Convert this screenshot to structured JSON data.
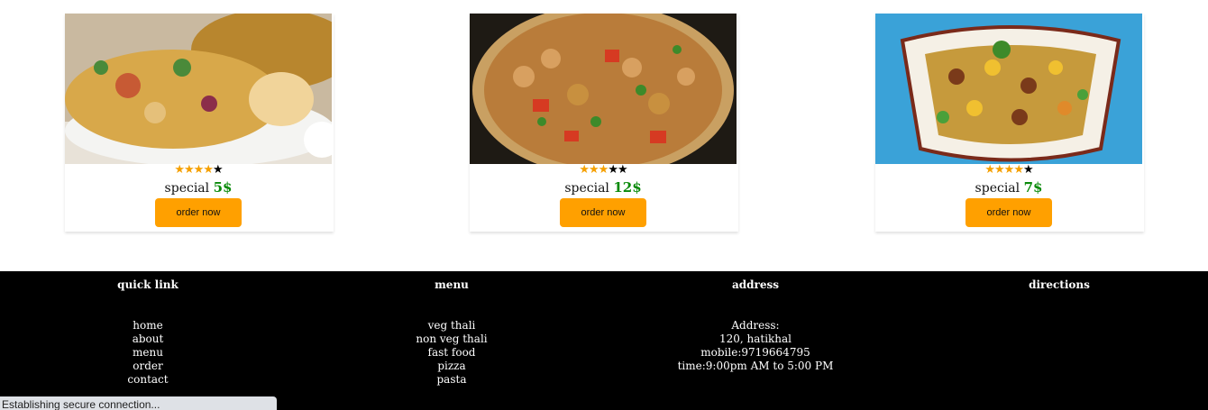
{
  "cards": [
    {
      "image_alt": "bhel puri plate",
      "rating_filled": 4,
      "rating_total": 5,
      "stars_filled": "★★★★",
      "stars_empty": "★",
      "title": "special",
      "price": "5$",
      "button_label": "order now"
    },
    {
      "image_alt": "chana chaat bowl",
      "rating_filled": 3,
      "rating_total": 5,
      "stars_filled": "★★★",
      "stars_empty": "★★",
      "title": "special",
      "price": "12$",
      "button_label": "order now"
    },
    {
      "image_alt": "masala chana plate",
      "rating_filled": 4,
      "rating_total": 5,
      "stars_filled": "★★★★",
      "stars_empty": "★",
      "title": "special",
      "price": "7$",
      "button_label": "order now"
    }
  ],
  "footer": {
    "quick_link": {
      "title": "quick link",
      "items": [
        "home",
        "about",
        "menu",
        "order",
        "contact"
      ]
    },
    "menu": {
      "title": "menu",
      "items": [
        "veg thali",
        "non veg thali",
        "fast food",
        "pizza",
        "pasta"
      ]
    },
    "address": {
      "title": "address",
      "lines": [
        "Address:",
        "120, hatikhal",
        "mobile:9719664795",
        "time:9:00pm AM to 5:00 PM"
      ]
    },
    "directions": {
      "title": "directions"
    }
  },
  "status_bar": "Establishing secure connection..."
}
